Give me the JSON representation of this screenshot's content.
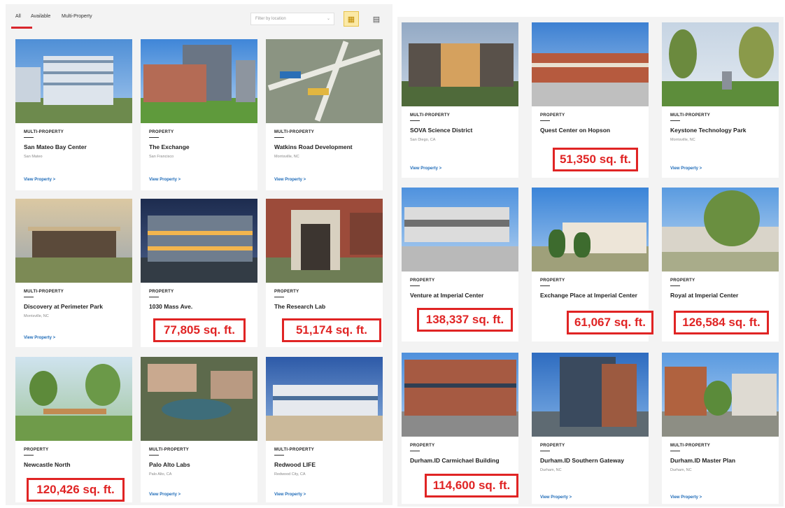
{
  "filters": {
    "tabs": [
      {
        "label": "All"
      },
      {
        "label": "Available"
      },
      {
        "label": "Multi-Property"
      }
    ],
    "location_placeholder": "Filter by location",
    "grid_view_icon": "grid-icon",
    "list_view_icon": "list-icon",
    "accent_color": "#d8262c"
  },
  "left_cards": [
    {
      "type": "MULTI-PROPERTY",
      "name": "San Mateo Bay Center",
      "location": "San Mateo",
      "link": "View Property >"
    },
    {
      "type": "PROPERTY",
      "name": "The Exchange",
      "location": "San Francisco",
      "link": "View Property >"
    },
    {
      "type": "MULTI-PROPERTY",
      "name": "Watkins Road Development",
      "location": "Morrisville, NC",
      "link": "View Property >"
    },
    {
      "type": "MULTI-PROPERTY",
      "name": "Discovery at Perimeter Park",
      "location": "Morrisville, NC",
      "link": "View Property >"
    },
    {
      "type": "PROPERTY",
      "name": "1030 Mass Ave.",
      "location": "",
      "link": ""
    },
    {
      "type": "PROPERTY",
      "name": "The Research Lab",
      "location": "",
      "link": ""
    },
    {
      "type": "PROPERTY",
      "name": "Newcastle North",
      "location": "",
      "link": ""
    },
    {
      "type": "MULTI-PROPERTY",
      "name": "Palo Alto Labs",
      "location": "Palo Alto, CA",
      "link": "View Property >"
    },
    {
      "type": "MULTI-PROPERTY",
      "name": "Redwood LIFE",
      "location": "Redwood City, CA",
      "link": "View Property >"
    }
  ],
  "right_cards": [
    {
      "type": "MULTI-PROPERTY",
      "name": "SOVA Science District",
      "location": "San Diego, CA",
      "link": "View Property >"
    },
    {
      "type": "PROPERTY",
      "name": "Quest Center on Hopson",
      "location": "",
      "link": ""
    },
    {
      "type": "MULTI-PROPERTY",
      "name": "Keystone Technology Park",
      "location": "Morrisville, NC",
      "link": "View Property >"
    },
    {
      "type": "PROPERTY",
      "name": "Venture at Imperial Center",
      "location": "",
      "link": ""
    },
    {
      "type": "PROPERTY",
      "name": "Exchange Place at Imperial Center",
      "location": "",
      "link": ""
    },
    {
      "type": "PROPERTY",
      "name": "Royal at Imperial Center",
      "location": "",
      "link": ""
    },
    {
      "type": "PROPERTY",
      "name": "Durham.ID Carmichael Building",
      "location": "",
      "link": ""
    },
    {
      "type": "PROPERTY",
      "name": "Durham.ID Southern Gateway",
      "location": "Durham, NC",
      "link": "View Property >"
    },
    {
      "type": "MULTI-PROPERTY",
      "name": "Durham.ID Master Plan",
      "location": "Durham, NC",
      "link": "View Property >"
    }
  ],
  "sqft_callouts": [
    {
      "text": "51,350 sq. ft."
    },
    {
      "text": "77,805 sq. ft."
    },
    {
      "text": "51,174 sq. ft."
    },
    {
      "text": "138,337 sq. ft."
    },
    {
      "text": "61,067 sq. ft."
    },
    {
      "text": "126,584 sq. ft."
    },
    {
      "text": "120,426 sq. ft."
    },
    {
      "text": "114,600 sq. ft."
    }
  ],
  "callout_color": "#e02424"
}
